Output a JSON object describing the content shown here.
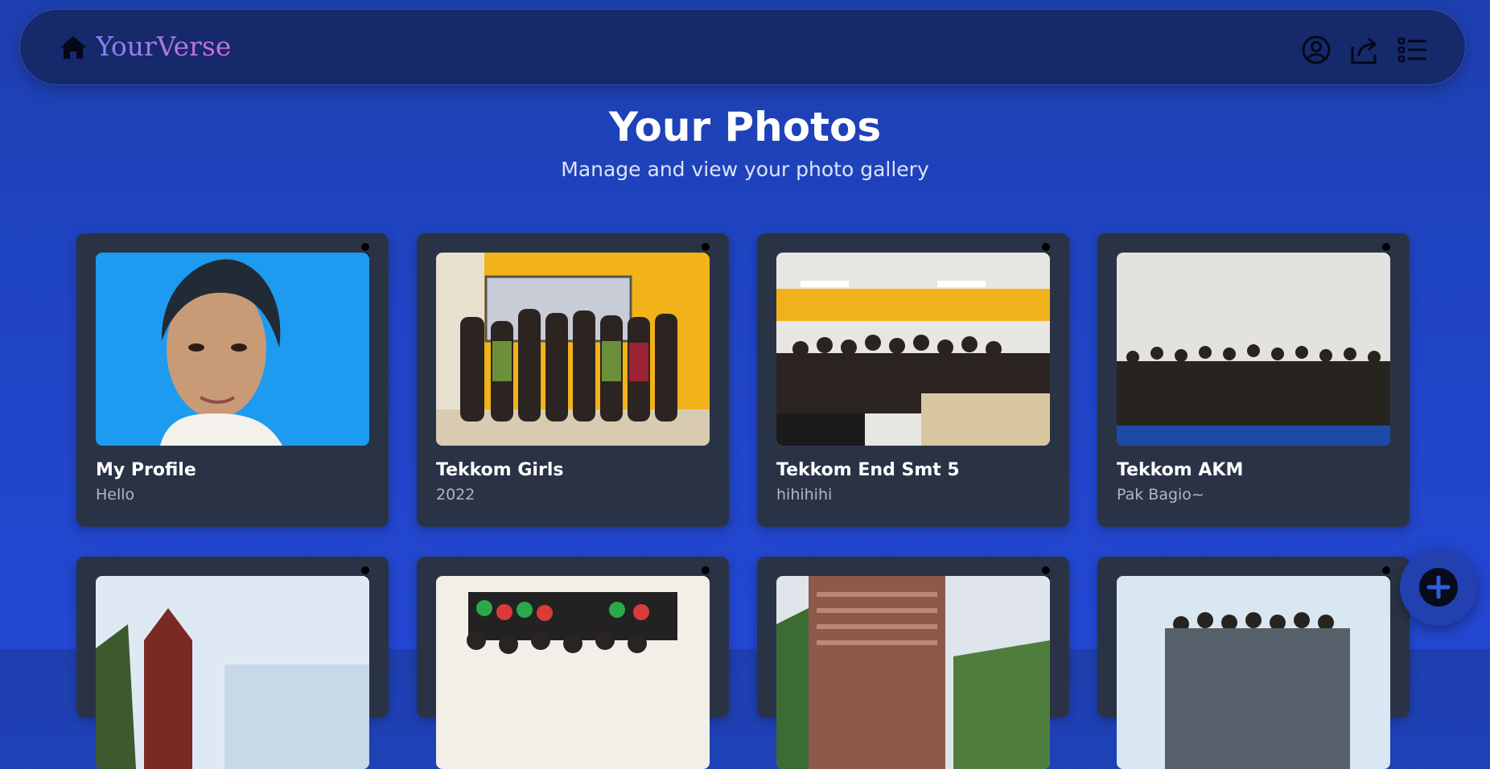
{
  "navbar": {
    "brand": "YourVerse",
    "icons": [
      "home-icon",
      "user-circle-icon",
      "share-icon",
      "list-icon"
    ]
  },
  "header": {
    "title": "Your Photos",
    "subtitle": "Manage and view your photo gallery"
  },
  "photos": [
    {
      "title": "My Profile",
      "caption": "Hello"
    },
    {
      "title": "Tekkom Girls",
      "caption": "2022"
    },
    {
      "title": "Tekkom End Smt 5",
      "caption": "hihihihi"
    },
    {
      "title": "Tekkom AKM",
      "caption": "Pak Bagio~"
    },
    {
      "title": "",
      "caption": ""
    },
    {
      "title": "",
      "caption": ""
    },
    {
      "title": "",
      "caption": ""
    },
    {
      "title": "",
      "caption": ""
    }
  ],
  "fab": {
    "icon": "plus-icon"
  },
  "colors": {
    "background": "#1f44c2",
    "navbar": "#15296b",
    "card": "#2a3346",
    "brand_gradient_start": "#7f86f3",
    "brand_gradient_end": "#d46ad6"
  }
}
